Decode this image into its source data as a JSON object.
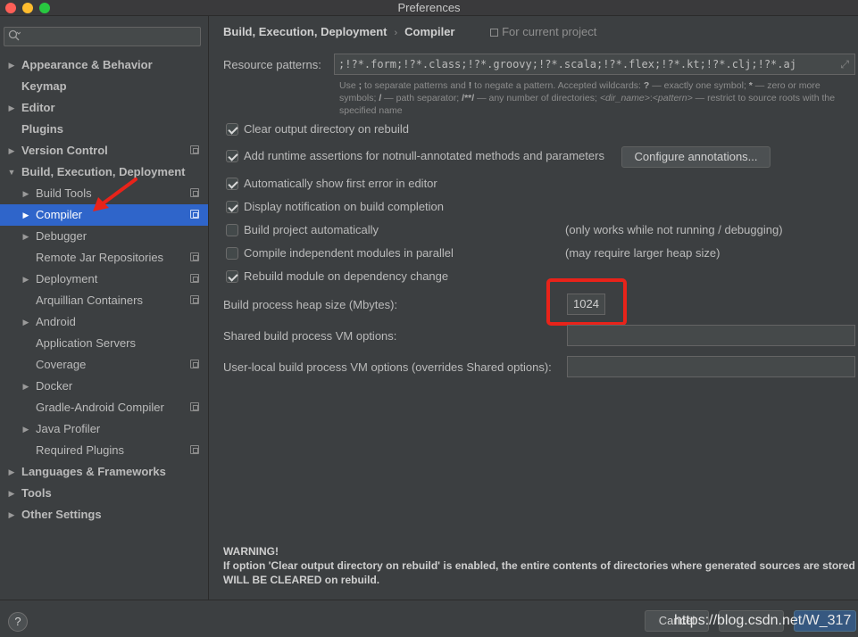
{
  "window": {
    "title": "Preferences"
  },
  "search": {
    "placeholder": "",
    "icon": "search-icon"
  },
  "sidebar": {
    "items": [
      {
        "label": "Appearance & Behavior",
        "level": 0,
        "arrow": true,
        "bold": true,
        "project_icon": false,
        "selected": false
      },
      {
        "label": "Keymap",
        "level": 0,
        "arrow": false,
        "bold": true,
        "project_icon": false,
        "selected": false
      },
      {
        "label": "Editor",
        "level": 0,
        "arrow": true,
        "bold": true,
        "project_icon": false,
        "selected": false
      },
      {
        "label": "Plugins",
        "level": 0,
        "arrow": false,
        "bold": true,
        "project_icon": false,
        "selected": false
      },
      {
        "label": "Version Control",
        "level": 0,
        "arrow": true,
        "bold": true,
        "project_icon": true,
        "selected": false
      },
      {
        "label": "Build, Execution, Deployment",
        "level": 0,
        "arrow": "down",
        "bold": true,
        "project_icon": false,
        "selected": false
      },
      {
        "label": "Build Tools",
        "level": 1,
        "arrow": true,
        "bold": false,
        "project_icon": true,
        "selected": false
      },
      {
        "label": "Compiler",
        "level": 1,
        "arrow": true,
        "bold": false,
        "project_icon": true,
        "selected": true
      },
      {
        "label": "Debugger",
        "level": 1,
        "arrow": true,
        "bold": false,
        "project_icon": false,
        "selected": false
      },
      {
        "label": "Remote Jar Repositories",
        "level": 1,
        "arrow": false,
        "bold": false,
        "project_icon": true,
        "selected": false
      },
      {
        "label": "Deployment",
        "level": 1,
        "arrow": true,
        "bold": false,
        "project_icon": true,
        "selected": false
      },
      {
        "label": "Arquillian Containers",
        "level": 1,
        "arrow": false,
        "bold": false,
        "project_icon": true,
        "selected": false
      },
      {
        "label": "Android",
        "level": 1,
        "arrow": true,
        "bold": false,
        "project_icon": false,
        "selected": false
      },
      {
        "label": "Application Servers",
        "level": 1,
        "arrow": false,
        "bold": false,
        "project_icon": false,
        "selected": false
      },
      {
        "label": "Coverage",
        "level": 1,
        "arrow": false,
        "bold": false,
        "project_icon": true,
        "selected": false
      },
      {
        "label": "Docker",
        "level": 1,
        "arrow": true,
        "bold": false,
        "project_icon": false,
        "selected": false
      },
      {
        "label": "Gradle-Android Compiler",
        "level": 1,
        "arrow": false,
        "bold": false,
        "project_icon": true,
        "selected": false
      },
      {
        "label": "Java Profiler",
        "level": 1,
        "arrow": true,
        "bold": false,
        "project_icon": false,
        "selected": false
      },
      {
        "label": "Required Plugins",
        "level": 1,
        "arrow": false,
        "bold": false,
        "project_icon": true,
        "selected": false
      },
      {
        "label": "Languages & Frameworks",
        "level": 0,
        "arrow": true,
        "bold": true,
        "project_icon": false,
        "selected": false
      },
      {
        "label": "Tools",
        "level": 0,
        "arrow": true,
        "bold": true,
        "project_icon": false,
        "selected": false
      },
      {
        "label": "Other Settings",
        "level": 0,
        "arrow": true,
        "bold": true,
        "project_icon": false,
        "selected": false
      }
    ]
  },
  "breadcrumb": {
    "parent": "Build, Execution, Deployment",
    "separator": "›",
    "current": "Compiler",
    "scope": "For current project"
  },
  "resource_patterns": {
    "label": "Resource patterns:",
    "value": ";!?*.form;!?*.class;!?*.groovy;!?*.scala;!?*.flex;!?*.kt;!?*.clj;!?*.aj",
    "expand_icon": "⤢"
  },
  "hint": {
    "p1": "Use ",
    "k1": ";",
    "p2": " to separate patterns and ",
    "k2": "!",
    "p3": " to negate a pattern. Accepted wildcards: ",
    "k3": "?",
    "p4": " — exactly one symbol; ",
    "k4": "*",
    "p5": " — zero or more symbols; ",
    "k5": "/",
    "p6": " — path separator; ",
    "k6": "/**/",
    "p7": " — any number of directories; ",
    "i1": "<dir_name>",
    "p8": ":",
    "i2": "<pattern>",
    "p9": " — restrict to source roots with the specified name"
  },
  "options": {
    "clear_output": {
      "label": "Clear output directory on rebuild",
      "checked": true
    },
    "runtime_assertions": {
      "label": "Add runtime assertions for notnull-annotated methods and parameters",
      "checked": true
    },
    "configure_annotations": {
      "label": "Configure annotations..."
    },
    "show_first_error": {
      "label": "Automatically show first error in editor",
      "checked": true
    },
    "display_notification": {
      "label": "Display notification on build completion",
      "checked": true
    },
    "build_automatically": {
      "label": "Build project automatically",
      "checked": false,
      "note": "(only works while not running / debugging)"
    },
    "compile_parallel": {
      "label": "Compile independent modules in parallel",
      "checked": false,
      "note": "(may require larger heap size)"
    },
    "rebuild_module": {
      "label": "Rebuild module on dependency change",
      "checked": true
    }
  },
  "heap": {
    "label": "Build process heap size (Mbytes):",
    "value": "1024"
  },
  "shared_vm": {
    "label": "Shared build process VM options:",
    "value": ""
  },
  "user_vm": {
    "label": "User-local build process VM options (overrides Shared options):",
    "value": ""
  },
  "warning": {
    "title": "WARNING!",
    "text": "If option 'Clear output directory on rebuild' is enabled, the entire contents of directories where generated sources are stored WILL BE CLEARED on rebuild."
  },
  "footer": {
    "help": "?",
    "cancel": "Cancel",
    "watermark": "https://blog.csdn.net/W_317"
  },
  "colors": {
    "accent": "#2f65ca",
    "annotation": "#e8231a",
    "background": "#3c3f41"
  }
}
